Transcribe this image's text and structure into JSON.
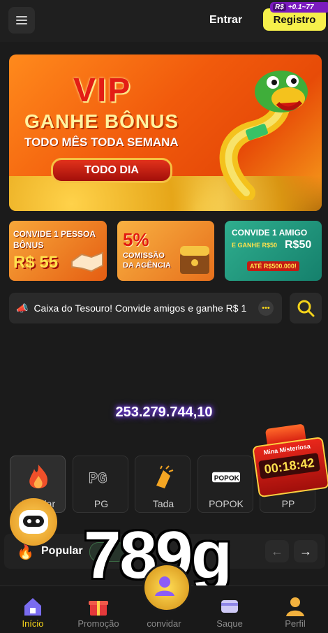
{
  "header": {
    "login_label": "Entrar",
    "register_label": "Registro",
    "register_badge_currency": "R$",
    "register_badge_text": "+0.1~77"
  },
  "banner": {
    "title": "VIP",
    "subtitle": "GANHE BÔNUS",
    "tagline": "TODO MÊS TODA SEMANA",
    "button": "TODO DIA"
  },
  "promos": [
    {
      "line1": "CONVIDE 1 PESSOA",
      "line2": "BÔNUS",
      "big": "R$ 55"
    },
    {
      "percent": "5%",
      "line1": "COMISSÃO",
      "line2": "DA AGÊNCIA"
    },
    {
      "line1": "CONVIDE 1 AMIGO",
      "line2": "E GANHE R$50",
      "big": "R$50",
      "line3": "ATÉ R$500.000!"
    }
  ],
  "notice": {
    "text": "Caixa do Tesouro! Convide amigos e ganhe R$ 1"
  },
  "jackpot": {
    "value": "253.279.744,10"
  },
  "categories": [
    {
      "label": "Popular",
      "icon": "fire-icon"
    },
    {
      "label": "PG",
      "icon": "pg-logo-icon"
    },
    {
      "label": "Tada",
      "icon": "tada-hand-icon"
    },
    {
      "label": "POPOK",
      "icon": "popok-logo-icon"
    },
    {
      "label": "PP",
      "icon": "pp-logo-icon"
    }
  ],
  "mystery": {
    "title": "Mina Misteriosa",
    "timer": "00:18:42"
  },
  "section": {
    "title": "Popular",
    "pill": "J"
  },
  "watermark": "789g",
  "nav": [
    {
      "label": "Início",
      "icon": "home-icon"
    },
    {
      "label": "Promoção",
      "icon": "gift-icon"
    },
    {
      "label": "convidar",
      "icon": "invite-icon"
    },
    {
      "label": "Saque",
      "icon": "withdraw-icon"
    },
    {
      "label": "Perfil",
      "icon": "profile-icon"
    }
  ],
  "colors": {
    "accent": "#f6f04b",
    "background": "#1b1b1b",
    "active_nav": "#f4d31a"
  }
}
